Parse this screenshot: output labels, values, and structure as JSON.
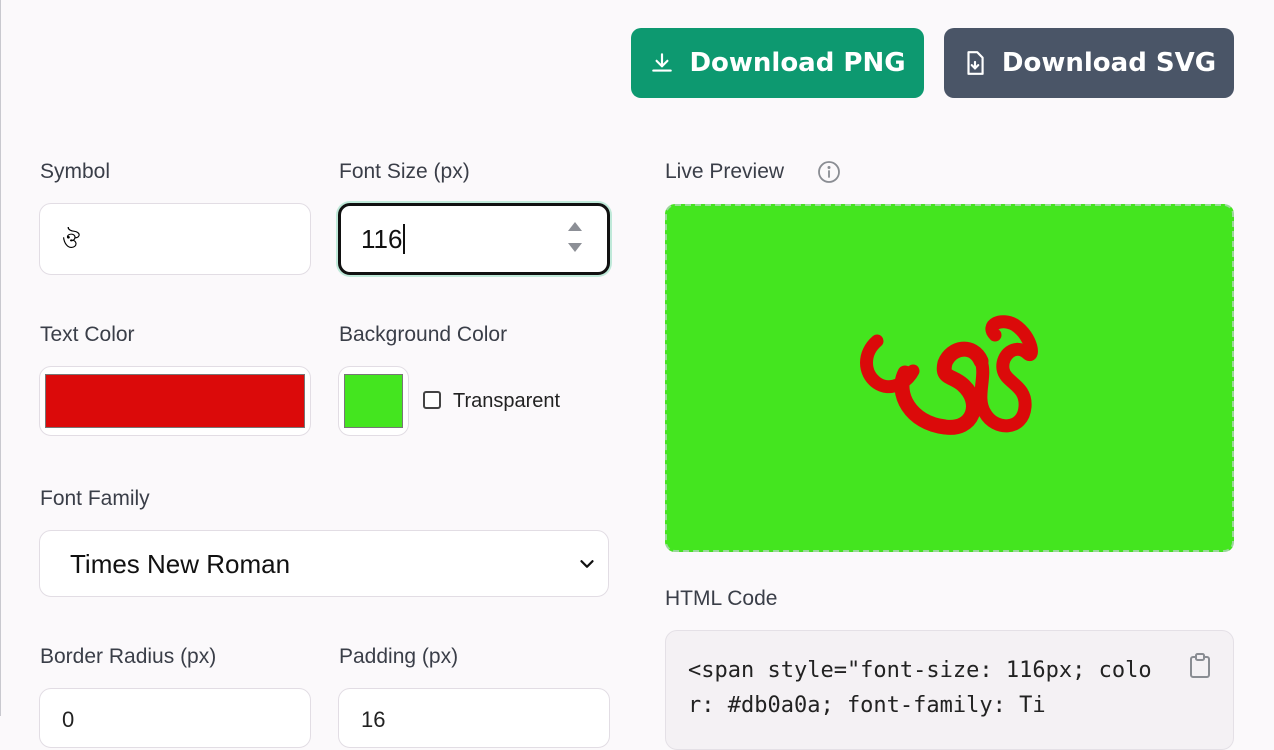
{
  "toolbar": {
    "download_png_label": "Download PNG",
    "download_svg_label": "Download SVG"
  },
  "form": {
    "symbol": {
      "label": "Symbol",
      "value": "ঔ"
    },
    "font_size": {
      "label": "Font Size (px)",
      "value": "116"
    },
    "text_color": {
      "label": "Text Color",
      "value": "#db0a0a"
    },
    "background_color": {
      "label": "Background Color",
      "value": "#44e51f",
      "transparent_label": "Transparent",
      "transparent_checked": false
    },
    "font_family": {
      "label": "Font Family",
      "selected": "Times New Roman"
    },
    "border_radius": {
      "label": "Border Radius (px)",
      "value": "0"
    },
    "padding": {
      "label": "Padding (px)",
      "value": "16"
    }
  },
  "preview": {
    "label": "Live Preview"
  },
  "html_code": {
    "label": "HTML Code",
    "code": "<span style=\"font-size: 116px; color: #db0a0a; font-family: Ti"
  },
  "colors": {
    "primary_button": "#0d9970",
    "secondary_button": "#4a5567",
    "text_color_swatch": "#db0a0a",
    "background_swatch": "#44e51f"
  },
  "icons": {
    "png": "download-icon",
    "svg": "file-download-icon",
    "info": "info-icon",
    "copy": "clipboard-icon",
    "select": "chevron-down-icon"
  }
}
